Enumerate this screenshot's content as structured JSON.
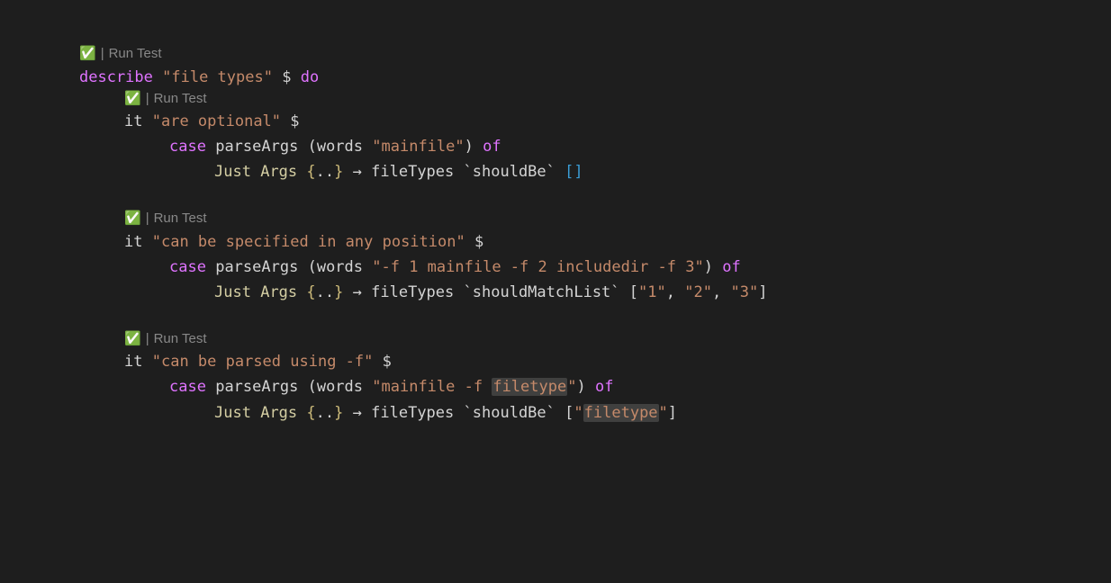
{
  "codelens": {
    "check_icon": "✅",
    "separator": "|",
    "run_test": "Run Test"
  },
  "code": {
    "kw_describe": "describe",
    "kw_do": "do",
    "kw_case": "case",
    "kw_of": "of",
    "fn_it": "it",
    "fn_parseArgs": "parseArgs",
    "fn_words": "words",
    "fn_fileTypes": "fileTypes",
    "ctor_Just": "Just",
    "ctor_Args": "Args",
    "op_dollar": "$",
    "op_arrow": "→",
    "brace_open": "{",
    "brace_close": "}",
    "dots": "..",
    "op_lbrack": "[",
    "op_rbrack": "]",
    "op_lparen": "(",
    "op_rparen": ")",
    "backtick": "`",
    "comma": ",",
    "space": " ",
    "shouldBe": "shouldBe",
    "shouldMatchList": "shouldMatchList",
    "describe_str": "\"file types\"",
    "test1_name": "\"are optional\"",
    "test1_arg": "\"mainfile\"",
    "test2_name": "\"can be specified in any position\"",
    "test2_arg": "\"-f 1 mainfile -f 2 includedir -f 3\"",
    "test2_v1": "\"1\"",
    "test2_v2": "\"2\"",
    "test2_v3": "\"3\"",
    "test3_name": "\"can be parsed using -f\"",
    "test3_arg_a": "\"mainfile -f ",
    "test3_arg_hl": "filetype",
    "test3_arg_b": "\"",
    "test3_res_a": "\"",
    "test3_res_hl": "filetype",
    "test3_res_b": "\""
  }
}
